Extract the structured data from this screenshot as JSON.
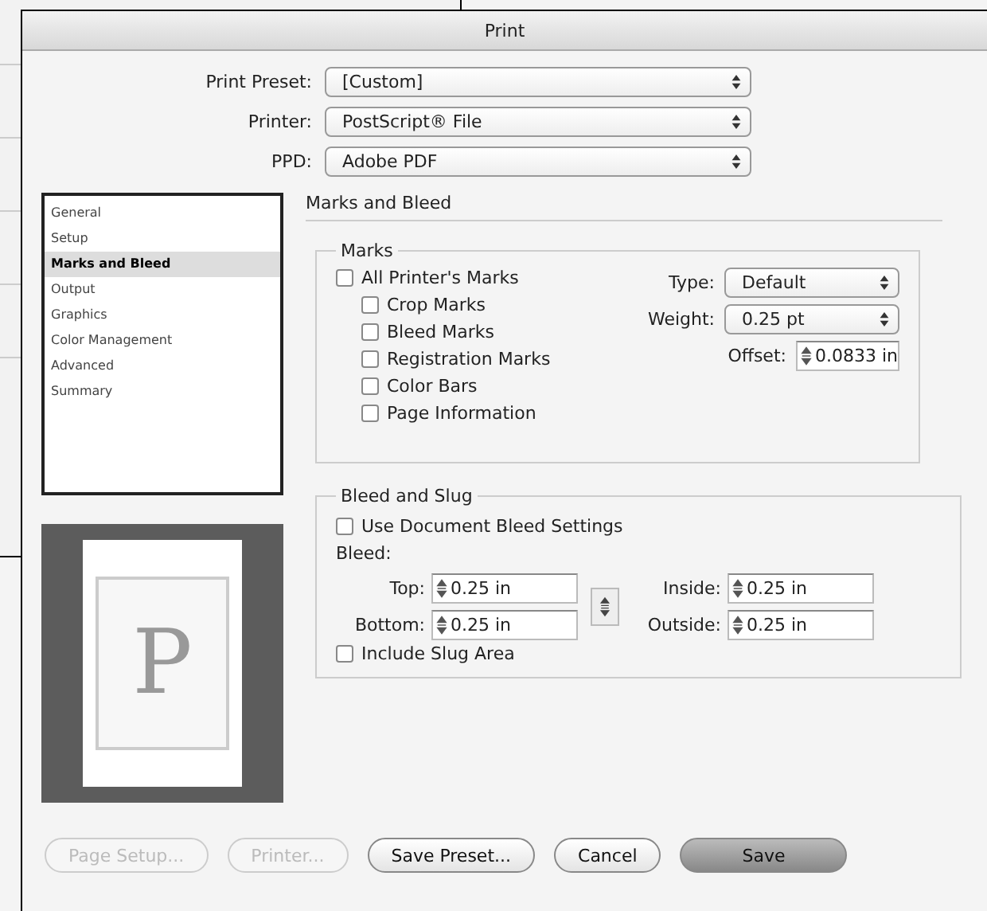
{
  "window": {
    "title": "Print"
  },
  "top_fields": [
    {
      "label": "Print Preset:",
      "value": "[Custom]"
    },
    {
      "label": "Printer:",
      "value": "PostScript® File"
    },
    {
      "label": "PPD:",
      "value": "Adobe PDF"
    }
  ],
  "sidebar": {
    "items": [
      {
        "label": "General",
        "selected": false
      },
      {
        "label": "Setup",
        "selected": false
      },
      {
        "label": "Marks and Bleed",
        "selected": true
      },
      {
        "label": "Output",
        "selected": false
      },
      {
        "label": "Graphics",
        "selected": false
      },
      {
        "label": "Color Management",
        "selected": false
      },
      {
        "label": "Advanced",
        "selected": false
      },
      {
        "label": "Summary",
        "selected": false
      }
    ]
  },
  "section_title": "Marks and Bleed",
  "marks": {
    "title": "Marks",
    "checkboxes": [
      {
        "label": "All Printer's Marks",
        "checked": false,
        "children": [
          {
            "label": "Crop Marks",
            "checked": false
          },
          {
            "label": "Bleed Marks",
            "checked": false
          },
          {
            "label": "Registration Marks",
            "checked": false
          },
          {
            "label": "Color Bars",
            "checked": false
          },
          {
            "label": "Page Information",
            "checked": false
          }
        ]
      }
    ],
    "fields": [
      {
        "kind": "popup",
        "label": "Type:",
        "value": "Default"
      },
      {
        "kind": "popup",
        "label": "Weight:",
        "value": "0.25 pt"
      },
      {
        "kind": "stepper",
        "label": "Offset:",
        "value": "0.0833 in"
      }
    ]
  },
  "preview": {
    "letter": "P"
  },
  "bleed_slug": {
    "title": "Bleed and Slug",
    "use_document": {
      "label": "Use Document Bleed Settings",
      "checked": false
    },
    "bleed_label": "Bleed:",
    "left": [
      {
        "label": "Top:",
        "value": "0.25 in"
      },
      {
        "label": "Bottom:",
        "value": "0.25 in"
      }
    ],
    "right": [
      {
        "label": "Inside:",
        "value": "0.25 in"
      },
      {
        "label": "Outside:",
        "value": "0.25 in"
      }
    ],
    "include_slug": {
      "label": "Include Slug Area",
      "checked": false
    }
  },
  "buttons": [
    {
      "label": "Page Setup...",
      "disabled": true,
      "default": false
    },
    {
      "label": "Printer...",
      "disabled": true,
      "default": false
    },
    {
      "label": "Save Preset...",
      "disabled": false,
      "default": false
    },
    {
      "label": "Cancel",
      "disabled": false,
      "default": false
    },
    {
      "label": "Save",
      "disabled": false,
      "default": true
    }
  ]
}
